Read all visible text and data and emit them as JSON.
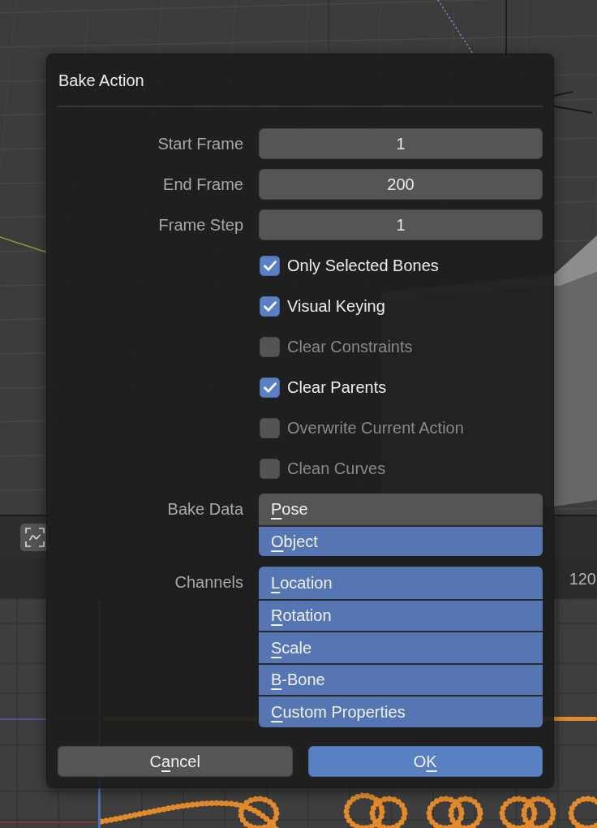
{
  "dialog": {
    "title": "Bake Action",
    "number_fields": [
      {
        "label": "Start Frame",
        "value": "1"
      },
      {
        "label": "End Frame",
        "value": "200"
      },
      {
        "label": "Frame Step",
        "value": "1"
      }
    ],
    "checkboxes": [
      {
        "label": "Only Selected Bones",
        "checked": true
      },
      {
        "label": "Visual Keying",
        "checked": true
      },
      {
        "label": "Clear Constraints",
        "checked": false
      },
      {
        "label": "Clear Parents",
        "checked": true
      },
      {
        "label": "Overwrite Current Action",
        "checked": false
      },
      {
        "label": "Clean Curves",
        "checked": false
      }
    ],
    "enum_groups": [
      {
        "label": "Bake Data",
        "options": [
          {
            "parts": [
              {
                "text": "P",
                "underlined": true
              },
              {
                "text": "ose",
                "underlined": false
              }
            ],
            "selected": false
          },
          {
            "parts": [
              {
                "text": "O",
                "underlined": true
              },
              {
                "text": "bject",
                "underlined": false
              }
            ],
            "selected": true
          }
        ]
      },
      {
        "label": "Channels",
        "options": [
          {
            "parts": [
              {
                "text": "L",
                "underlined": true
              },
              {
                "text": "ocation",
                "underlined": false
              }
            ],
            "selected": true
          },
          {
            "parts": [
              {
                "text": "R",
                "underlined": true
              },
              {
                "text": "otation",
                "underlined": false
              }
            ],
            "selected": true
          },
          {
            "parts": [
              {
                "text": "S",
                "underlined": true
              },
              {
                "text": "cale",
                "underlined": false
              }
            ],
            "selected": true
          },
          {
            "parts": [
              {
                "text": "B",
                "underlined": true
              },
              {
                "text": "-Bone",
                "underlined": false
              }
            ],
            "selected": true
          },
          {
            "parts": [
              {
                "text": "C",
                "underlined": true
              },
              {
                "text": "ustom Properties",
                "underlined": false
              }
            ],
            "selected": true
          }
        ]
      }
    ],
    "buttons": [
      {
        "kind": "secondary",
        "parts": [
          {
            "text": "C",
            "underlined": false
          },
          {
            "text": "a",
            "underlined": true
          },
          {
            "text": "ncel",
            "underlined": false
          }
        ]
      },
      {
        "kind": "primary",
        "parts": [
          {
            "text": "O",
            "underlined": false
          },
          {
            "text": "K",
            "underlined": true
          }
        ]
      }
    ]
  },
  "graph_editor": {
    "ruler_labels": [
      "120"
    ]
  }
}
